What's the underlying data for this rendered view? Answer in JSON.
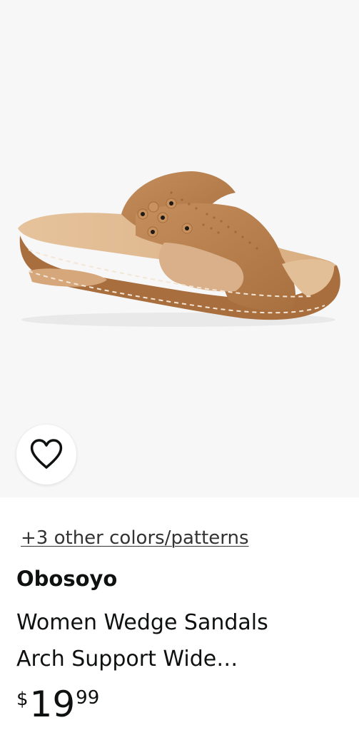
{
  "product": {
    "image_alt": "Women wedge slide sandal",
    "wishlist_icon": "heart-outline-icon",
    "colors_link": "+3 other colors/patterns",
    "brand": "Obosoyo",
    "title_line1": "Women Wedge Sandals",
    "title_line2": "Arch Support Wide…",
    "price": {
      "symbol": "$",
      "whole": "19",
      "fraction": "99"
    }
  },
  "colors": {
    "image_background": "#f7f7f7",
    "sandal_tan": "#b9824f",
    "text": "#0f1111"
  }
}
